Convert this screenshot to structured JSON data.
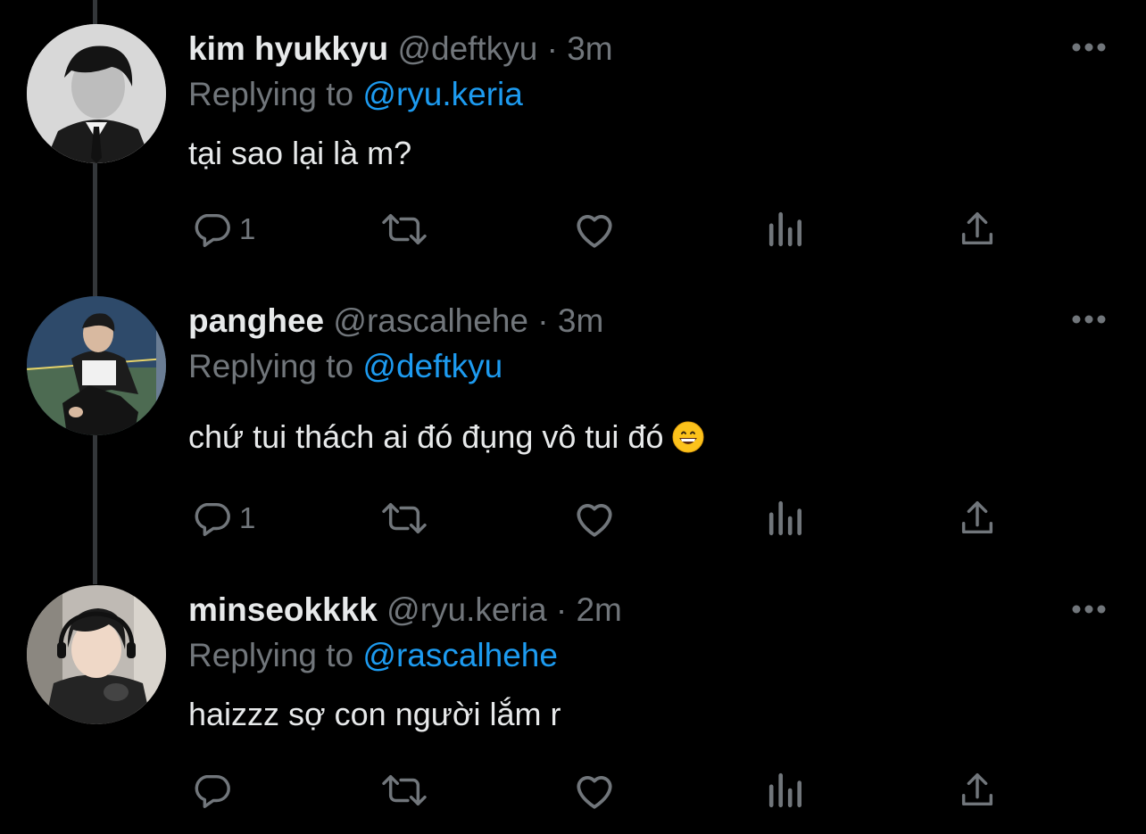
{
  "tweets": [
    {
      "name": "kim hyukkyu",
      "handle": "@deftkyu",
      "dot": "·",
      "time": "3m",
      "replying_label": "Replying to",
      "replying_to": "@ryu.keria",
      "text": "tại sao lại là m?",
      "reply_count": "1"
    },
    {
      "name": "panghee",
      "handle": "@rascalhehe",
      "dot": "·",
      "time": "3m",
      "replying_label": "Replying to",
      "replying_to": "@deftkyu",
      "text": "chứ tui thách ai đó đụng vô tui đó",
      "reply_count": "1"
    },
    {
      "name": "minseokkkk",
      "handle": "@ryu.keria",
      "dot": "·",
      "time": "2m",
      "replying_label": "Replying to",
      "replying_to": "@rascalhehe",
      "text": "haizzz sợ con người lắm r",
      "reply_count": ""
    }
  ],
  "icons": {
    "reply": "reply-icon",
    "retweet": "retweet-icon",
    "like": "heart-icon",
    "views": "views-icon",
    "share": "share-icon",
    "more": "more-icon",
    "emoji": "grinning-face-emoji"
  },
  "colors": {
    "background": "#000000",
    "primary_text": "#e7e9ea",
    "secondary_text": "#71767b",
    "mention": "#1d9bf0",
    "thread_line": "#333639"
  }
}
